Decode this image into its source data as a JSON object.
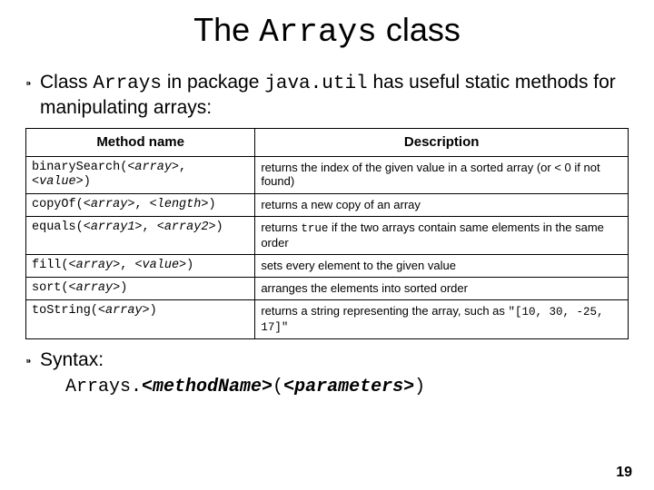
{
  "title": {
    "pre": "The ",
    "code": "Arrays",
    "post": " class"
  },
  "bullet1": {
    "t1": "Class ",
    "c1": "Arrays",
    "t2": " in package ",
    "c2": "java.util",
    "t3": " has useful static methods for manipulating arrays:"
  },
  "headers": {
    "method": "Method name",
    "desc": "Description"
  },
  "rows": [
    {
      "m_pre": "binarySearch(",
      "m_a1": "<array>",
      "m_mid": ", ",
      "m_a2": "<value>",
      "m_post": ")",
      "d": "returns the index of the given value in a sorted array (or < 0 if not found)"
    },
    {
      "m_pre": "copyOf(",
      "m_a1": "<array>",
      "m_mid": ", ",
      "m_a2": "<length>",
      "m_post": ")",
      "d": "returns a new copy of an array"
    },
    {
      "m_pre": "equals(",
      "m_a1": "<array1>",
      "m_mid": ", ",
      "m_a2": "<array2>",
      "m_post": ")",
      "d_pre": "returns ",
      "d_code": "true",
      "d_post": " if the two arrays contain same elements in the same order"
    },
    {
      "m_pre": "fill(",
      "m_a1": "<array>",
      "m_mid": ", ",
      "m_a2": "<value>",
      "m_post": ")",
      "d": "sets every element to the given value"
    },
    {
      "m_pre": "sort(",
      "m_a1": "<array>",
      "m_mid": "",
      "m_a2": "",
      "m_post": ")",
      "d": "arranges the elements into sorted order"
    },
    {
      "m_pre": "toString(",
      "m_a1": "<array>",
      "m_mid": "",
      "m_a2": "",
      "m_post": ")",
      "d_pre": "returns a string representing the array, such as ",
      "d_code": "\"[10, 30, -25, 17]\"",
      "d_post": ""
    }
  ],
  "bullet2": {
    "label": "Syntax:"
  },
  "syntax": {
    "c1": "Arrays.",
    "bi1": "<methodName>",
    "c2": "(",
    "bi2": "<parameters>",
    "c3": ")"
  },
  "pageNumber": "19"
}
